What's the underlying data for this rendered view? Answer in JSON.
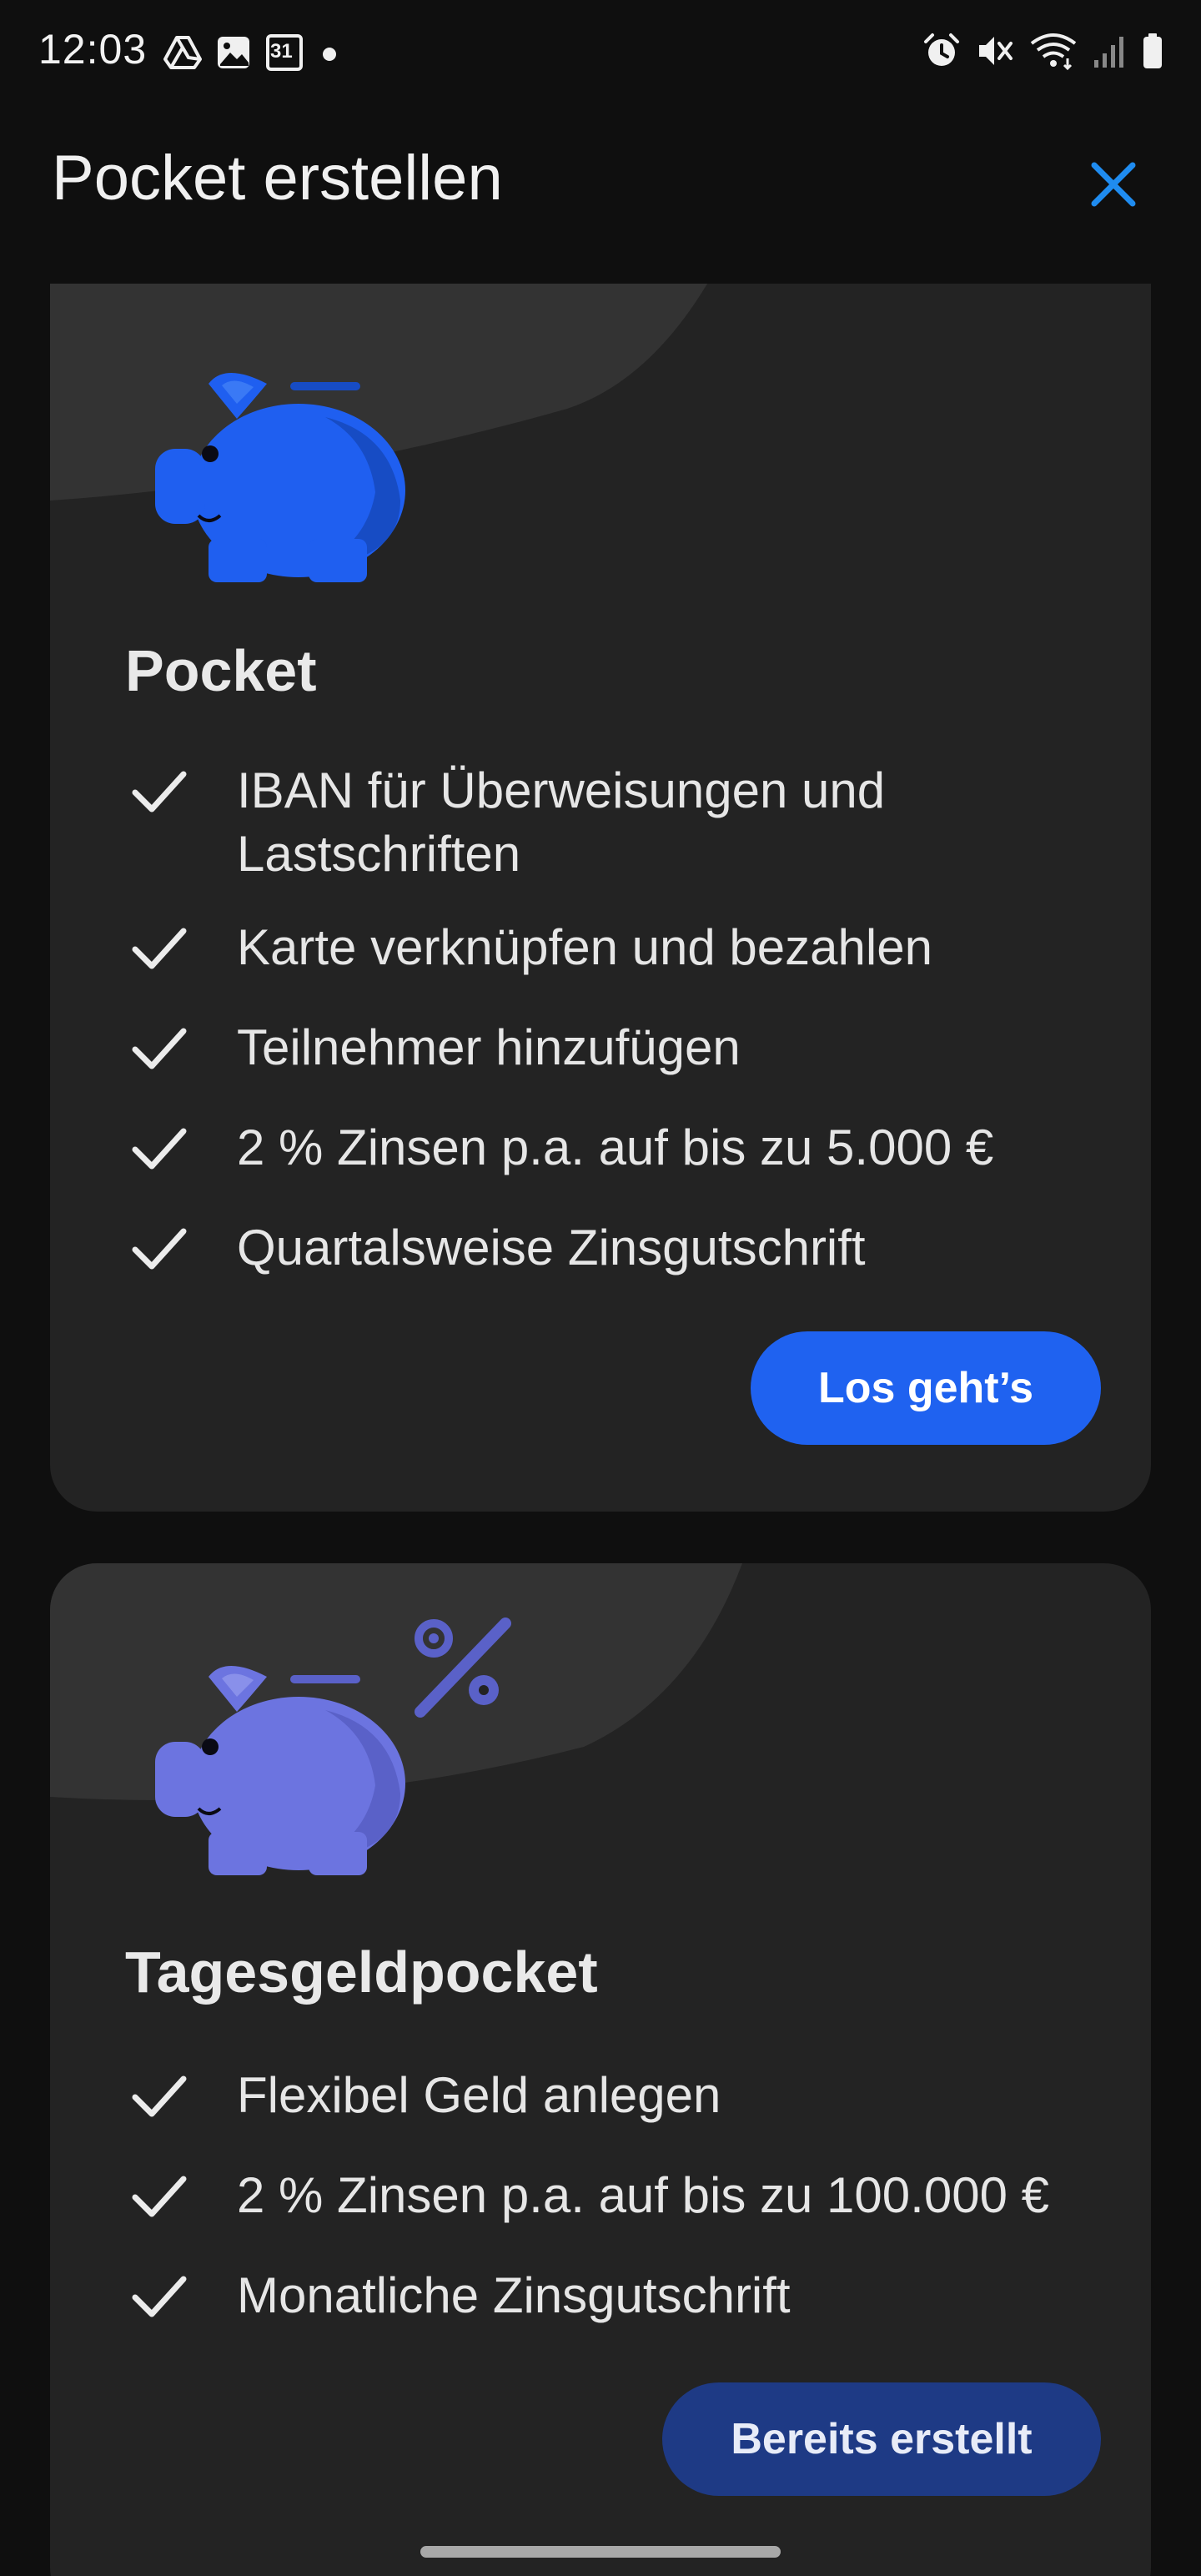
{
  "status_bar": {
    "time": "12:03",
    "calendar_day": "31",
    "left_icons": [
      "drive-icon",
      "gallery-icon",
      "calendar-icon",
      "dot-icon"
    ],
    "right_icons": [
      "alarm-icon",
      "mute-icon",
      "wifi-icon",
      "signal-icon",
      "battery-icon"
    ]
  },
  "header": {
    "title": "Pocket erstellen",
    "close_icon": "close-icon"
  },
  "colors": {
    "accent": "#1f62f0",
    "close": "#1f8cf0",
    "card_bg": "#232323",
    "page_bg": "#0f0f0f",
    "piggy_blue": "#1f5ff0",
    "piggy_purple": "#6c74e0",
    "button_disabled": "#1e3a85"
  },
  "cards": [
    {
      "title": "Pocket",
      "illustration": "piggy-bank-icon",
      "features": [
        "IBAN für Überweisungen und Lastschriften",
        "Karte verknüpfen und bezahlen",
        "Teilnehmer hinzufügen",
        "2 % Zinsen p.a. auf bis zu 5.000 €",
        "Quartalsweise Zinsgutschrift"
      ],
      "button_label": "Los geht’s"
    },
    {
      "title": "Tagesgeldpocket",
      "illustration": "piggy-bank-percent-icon",
      "features": [
        "Flexibel Geld anlegen",
        "2 % Zinsen p.a. auf bis zu 100.000 €",
        "Monatliche Zinsgutschrift"
      ],
      "button_label": "Bereits erstellt"
    }
  ]
}
